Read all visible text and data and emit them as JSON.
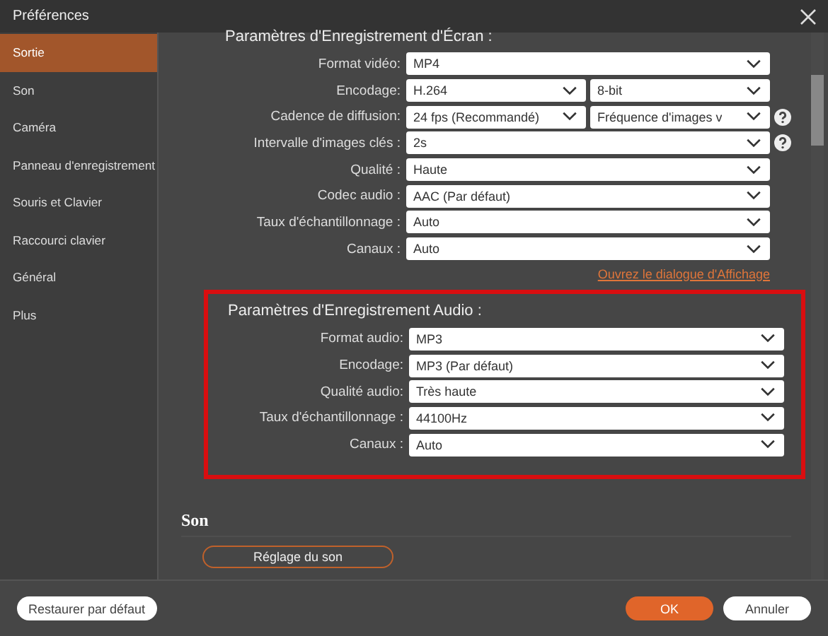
{
  "window": {
    "title": "Préférences"
  },
  "sidebar": {
    "items": [
      {
        "label": "Sortie",
        "selected": true
      },
      {
        "label": "Son",
        "selected": false
      },
      {
        "label": "Caméra",
        "selected": false
      },
      {
        "label": "Panneau d'enregistrement",
        "selected": false
      },
      {
        "label": "Souris et Clavier",
        "selected": false
      },
      {
        "label": "Raccourci clavier",
        "selected": false
      },
      {
        "label": "Général",
        "selected": false
      },
      {
        "label": "Plus",
        "selected": false
      }
    ]
  },
  "screen_settings": {
    "heading": "Paramètres d'Enregistrement d'Écran :",
    "rows": [
      {
        "label": "Format vidéo:",
        "value": "MP4",
        "help": false
      },
      {
        "label": "Encodage:",
        "value": "H.264",
        "value2": "8-bit",
        "help": false
      },
      {
        "label": "Cadence de diffusion:",
        "value": "24 fps (Recommandé)",
        "value2": "Fréquence d'images v",
        "help": true
      },
      {
        "label": "Intervalle d'images clés :",
        "value": "2s",
        "help": true
      },
      {
        "label": "Qualité :",
        "value": "Haute",
        "help": false
      },
      {
        "label": "Codec audio :",
        "value": "AAC (Par défaut)",
        "help": false
      },
      {
        "label": "Taux d'échantillonnage :",
        "value": "Auto",
        "help": false
      },
      {
        "label": "Canaux :",
        "value": "Auto",
        "help": false
      }
    ],
    "link": "Ouvrez le dialogue d'Affichage"
  },
  "audio_settings": {
    "heading": "Paramètres d'Enregistrement Audio :",
    "highlighted": true,
    "rows": [
      {
        "label": "Format audio:",
        "value": "MP3"
      },
      {
        "label": "Encodage:",
        "value": "MP3 (Par défaut)"
      },
      {
        "label": "Qualité audio:",
        "value": "Très haute"
      },
      {
        "label": "Taux d'échantillonnage :",
        "value": "44100Hz"
      },
      {
        "label": "Canaux :",
        "value": "Auto"
      }
    ]
  },
  "sound": {
    "heading": "Son",
    "button": "Réglage du son"
  },
  "footer": {
    "restore": "Restaurer par défaut",
    "ok": "OK",
    "cancel": "Annuler"
  }
}
